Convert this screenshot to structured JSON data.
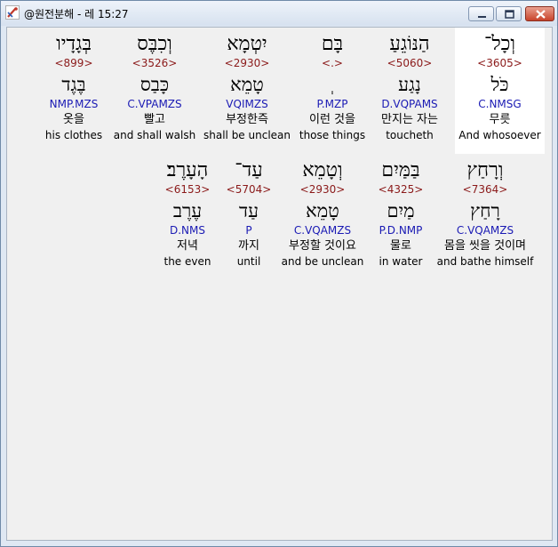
{
  "window": {
    "title": "@원전분해 - 레 15:27"
  },
  "rows": [
    [
      {
        "id": "w1",
        "hebrew": "וְכָל־",
        "strong": "<3605>",
        "lemma": "כֹּל",
        "morph": "C.NMSG",
        "korean": "무릇",
        "english": "And whosoever",
        "highlight": true
      },
      {
        "id": "w2",
        "hebrew": "הַנּוֹגֵעַ",
        "strong": "<5060>",
        "lemma": "נָגַע",
        "morph": "D.VQPAMS",
        "korean": "만지는 자는",
        "english": "toucheth",
        "highlight": false
      },
      {
        "id": "w3",
        "hebrew": "בָּם",
        "strong": "<.>",
        "lemma": "ְ",
        "morph": "P.MZP",
        "korean": "이런 것을",
        "english": "those things",
        "highlight": false
      },
      {
        "id": "w4",
        "hebrew": "יִטְמָא",
        "strong": "<2930>",
        "lemma": "טָמֵא",
        "morph": "VQIMZS",
        "korean": "부정한즉",
        "english": "shall be unclean",
        "highlight": false
      },
      {
        "id": "w5",
        "hebrew": "וְכִבֶּס",
        "strong": "<3526>",
        "lemma": "כָּבַס",
        "morph": "C.VPAMZS",
        "korean": "빨고",
        "english": "and shall walsh",
        "highlight": false
      },
      {
        "id": "w6",
        "hebrew": "בְּגָדָיו",
        "strong": "<899>",
        "lemma": "בֶּגֶד",
        "morph": "NMP.MZS",
        "korean": "옷을",
        "english": "his clothes",
        "highlight": false
      }
    ],
    [
      {
        "id": "w7",
        "hebrew": "וְרָחַץ",
        "strong": "<7364>",
        "lemma": "רָחַץ",
        "morph": "C.VQAMZS",
        "korean": "몸을 씻을 것이며",
        "english": "and bathe himself",
        "highlight": false
      },
      {
        "id": "w8",
        "hebrew": "בַּמַּיִם",
        "strong": "<4325>",
        "lemma": "מַיִם",
        "morph": "P.D.NMP",
        "korean": "물로",
        "english": "in water",
        "highlight": false
      },
      {
        "id": "w9",
        "hebrew": "וְטָמֵא",
        "strong": "<2930>",
        "lemma": "טָמֵא",
        "morph": "C.VQAMZS",
        "korean": "부정할 것이요",
        "english": "and be unclean",
        "highlight": false
      },
      {
        "id": "w10",
        "hebrew": "עַד־",
        "strong": "<5704>",
        "lemma": "עַד",
        "morph": "P",
        "korean": "까지",
        "english": "until",
        "highlight": false
      },
      {
        "id": "w11",
        "hebrew": "הָעָרֶב׃",
        "strong": "<6153>",
        "lemma": "עֶרֶב",
        "morph": "D.NMS",
        "korean": "저녁",
        "english": "the even",
        "highlight": false
      }
    ]
  ]
}
